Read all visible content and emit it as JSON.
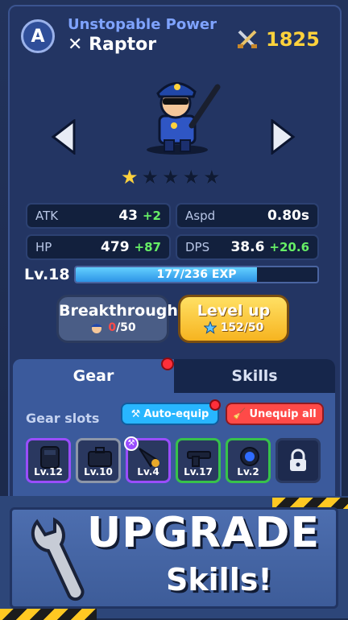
{
  "header": {
    "rank_letter": "A",
    "title": "Unstopable Power",
    "hero_name": "✕ Raptor",
    "power_value": "1825"
  },
  "hero": {
    "stars_total": 5,
    "stars_filled": 1
  },
  "stats": {
    "atk": {
      "label": "ATK",
      "value": "43",
      "bonus": "+2"
    },
    "aspd": {
      "label": "Aspd",
      "value": "0.80s"
    },
    "hp": {
      "label": "HP",
      "value": "479",
      "bonus": "+87"
    },
    "dps": {
      "label": "DPS",
      "value": "38.6",
      "bonus": "+20.6"
    }
  },
  "level": {
    "label": "Lv.18",
    "exp_text": "177/236 EXP",
    "exp_current": 177,
    "exp_max": 236
  },
  "buttons": {
    "breakthrough": {
      "label": "Breakthrough",
      "have": "0",
      "need": "/50"
    },
    "level_up": {
      "label": "Level up",
      "cost": "152/50"
    }
  },
  "tabs": {
    "gear": "Gear",
    "skills": "Skills"
  },
  "gear": {
    "slots_label": "Gear slots",
    "auto_equip": "Auto-equip",
    "unequip_all": "Unequip all",
    "slots": [
      {
        "level": "Lv.12",
        "rarity_color": "#9a4dff",
        "icon": "armor-icon"
      },
      {
        "level": "Lv.10",
        "rarity_color": "#8d96a8",
        "icon": "case-icon"
      },
      {
        "level": "Lv.4",
        "rarity_color": "#9a4dff",
        "icon": "drill-icon"
      },
      {
        "level": "Lv.17",
        "rarity_color": "#37c24a",
        "icon": "gun-icon"
      },
      {
        "level": "Lv.2",
        "rarity_color": "#37c24a",
        "icon": "orb-icon"
      }
    ]
  },
  "banner": {
    "line1": "UPGRADE",
    "line2": "Skills!"
  },
  "colors": {
    "gold": "#ffd23c",
    "bonus_green": "#66ee66",
    "exp_blue": "#2e94e6"
  }
}
